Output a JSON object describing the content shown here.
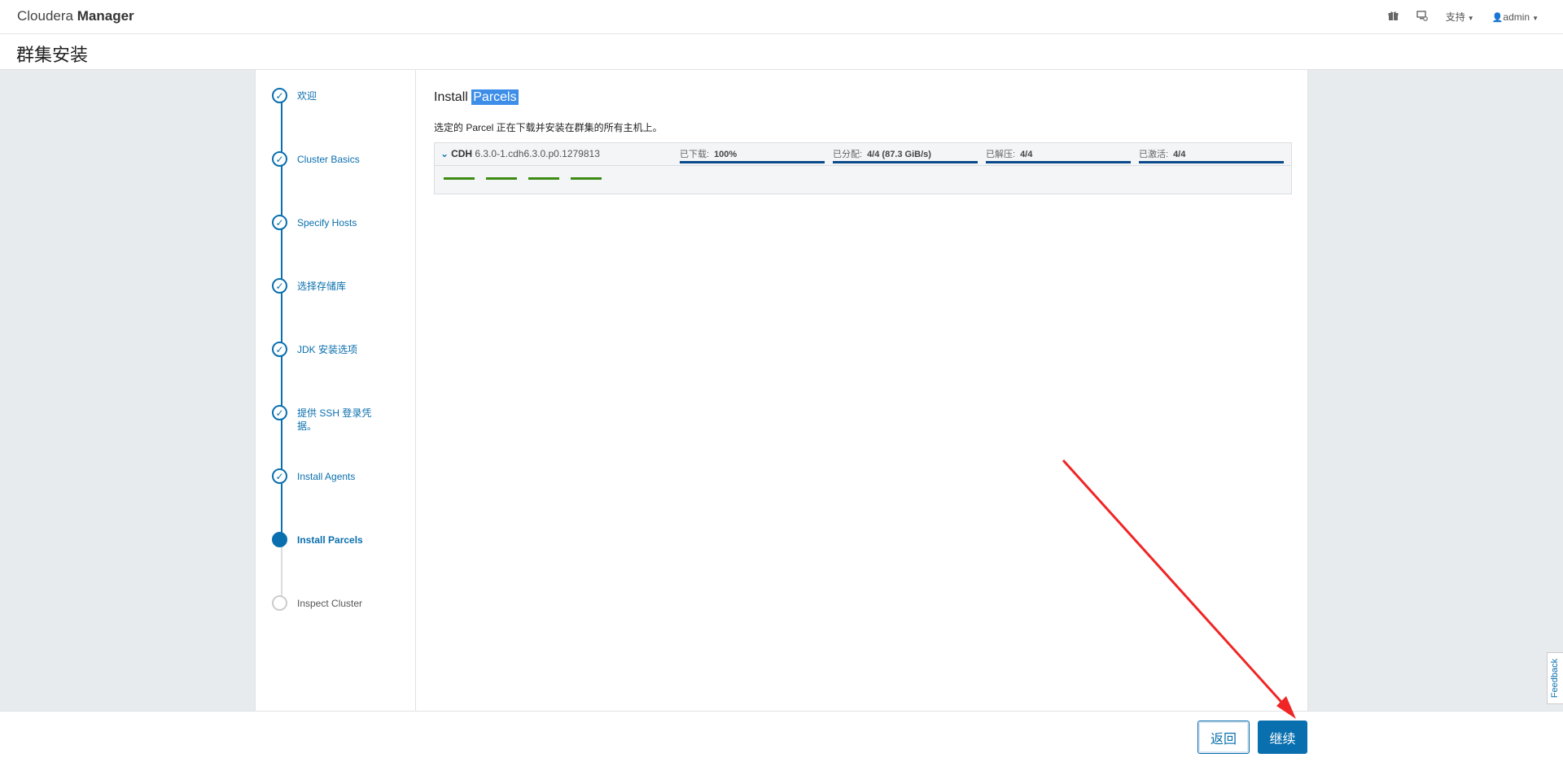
{
  "topbar": {
    "brand_light": "Cloudera",
    "brand_bold": "Manager",
    "support_label": "支持",
    "user_label": "admin"
  },
  "page": {
    "title": "群集安装"
  },
  "steps": [
    {
      "label": "欢迎",
      "state": "done"
    },
    {
      "label": "Cluster Basics",
      "state": "done"
    },
    {
      "label": "Specify Hosts",
      "state": "done"
    },
    {
      "label": "选择存储库",
      "state": "done"
    },
    {
      "label": "JDK 安装选项",
      "state": "done"
    },
    {
      "label": "提供 SSH 登录凭据。",
      "state": "done"
    },
    {
      "label": "Install Agents",
      "state": "done"
    },
    {
      "label": "Install Parcels",
      "state": "active"
    },
    {
      "label": "Inspect Cluster",
      "state": "pending"
    }
  ],
  "main": {
    "heading_prefix": "Install",
    "heading_highlight": "Parcels",
    "description": "选定的 Parcel 正在下载并安装在群集的所有主机上。",
    "parcel": {
      "name": "CDH",
      "version": "6.3.0-1.cdh6.3.0.p0.1279813",
      "downloaded_label": "已下载:",
      "downloaded_value": "100%",
      "distributed_label": "已分配:",
      "distributed_value": "4/4 (87.3 GiB/s)",
      "unpacked_label": "已解压:",
      "unpacked_value": "4/4",
      "activated_label": "已激活:",
      "activated_value": "4/4",
      "host_progress": [
        1,
        1,
        1,
        1
      ]
    }
  },
  "footer": {
    "back_label": "返回",
    "continue_label": "继续"
  },
  "feedback_label": "Feedback",
  "colors": {
    "accent": "#0a6fae",
    "progress_dark": "#0a4a8a",
    "host_done": "#3b8b13",
    "annotation_arrow": "#f02525"
  }
}
